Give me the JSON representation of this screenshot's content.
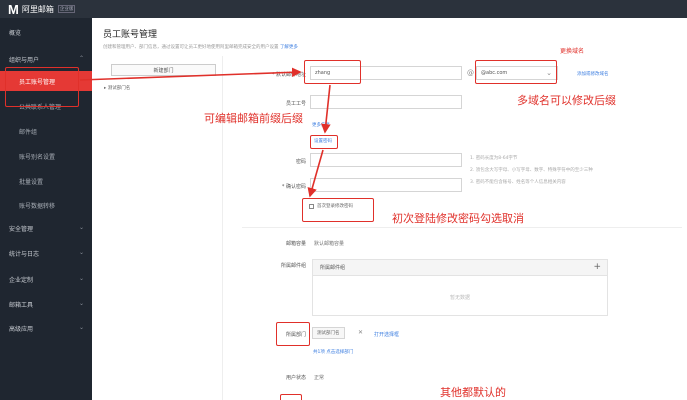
{
  "header": {
    "logo_mark": "M",
    "logo_text": "阿里邮箱",
    "logo_sub": "企业版"
  },
  "sidebar": {
    "items": [
      {
        "label": "概览",
        "chevron": ""
      },
      {
        "label": "组织与用户",
        "chevron": "⌃"
      },
      {
        "label": "员工账号管理",
        "chevron": ""
      },
      {
        "label": "公共联系人管理",
        "chevron": ""
      },
      {
        "label": "邮件组",
        "chevron": ""
      },
      {
        "label": "账号别名设置",
        "chevron": ""
      },
      {
        "label": "批量设置",
        "chevron": ""
      },
      {
        "label": "账号数据转移",
        "chevron": ""
      },
      {
        "label": "安全管理",
        "chevron": "⌄"
      },
      {
        "label": "统计与日志",
        "chevron": "⌄"
      },
      {
        "label": "企业定制",
        "chevron": "⌄"
      },
      {
        "label": "邮箱工具",
        "chevron": "⌄"
      },
      {
        "label": "高级应用",
        "chevron": "⌄"
      }
    ]
  },
  "main": {
    "title": "员工账号管理",
    "desc": "创建和管理用户、部门信息，通过设置可让员工更好地使用阿里邮箱完成安全的用户设置",
    "desc_link": "了解更多",
    "dept_button": "新建部门",
    "dept_node": "▸ 测试部门名",
    "form": {
      "email_label": "* 默认邮件地址",
      "email_value": "zhang",
      "domain_value": "@abc.com",
      "domain_link": "添加或修改域名",
      "empno_label": "员工工号",
      "more_link": "更多信息",
      "pwd_link": "设置密码",
      "pwd_label": "密码",
      "confirm_label": "* 确认密码",
      "hints": [
        "1. 密码长度为8-64字节",
        "2. 须包含大写字母、小写字母、数字、特殊字符中的至少三种",
        "3. 密码不能包含账号、姓名等个人信息相关内容"
      ],
      "first_login": "首次登录修改密码",
      "mailbox_label": "邮箱容量",
      "mailbox_value": "默认邮箱容量",
      "group_label": "所属邮件组",
      "group_head": "所属邮件组",
      "group_plus": "+",
      "group_empty": "暂无数据",
      "dept_label": "所属部门",
      "dept_tag": "测试部门名",
      "dept_tag_x": "✕",
      "dept_open": "打开选择框",
      "dept_links": "共1项   点击选择部门",
      "status_label": "用户状态",
      "status_value": "正常"
    }
  },
  "annotations": {
    "change_domain": "更换域名",
    "domain_editable": "多域名可以修改后缀",
    "prefix_editable": "可编辑邮箱前缀后缀",
    "first_login_uncheck": "初次登陆修改密码勾选取消",
    "others_default": "其他都默认的"
  },
  "colors": {
    "sidebar_bg": "#1f2630",
    "topbar_bg": "#2b323c",
    "active": "#e53935",
    "annotation": "#e0302a",
    "link": "#3b7de0"
  }
}
